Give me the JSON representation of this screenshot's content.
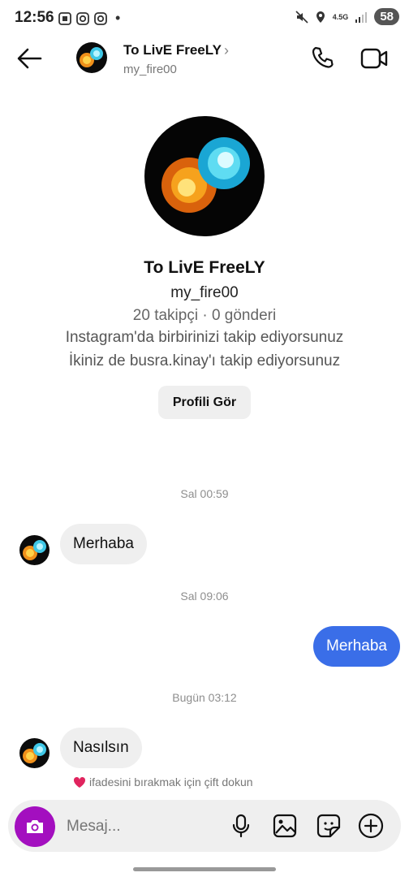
{
  "status_bar": {
    "time": "12:56",
    "network": "4.5G",
    "battery": "58"
  },
  "header": {
    "name": "To LivE FreeLY",
    "username": "my_fire00",
    "chevron": "›"
  },
  "profile": {
    "name": "To LivE FreeLY",
    "username": "my_fire00",
    "stats": "20 takipçi · 0 gönderi",
    "mutual_line": "Instagram'da birbirinizi takip ediyorsunuz",
    "common_line": "İkiniz de busra.kinay'ı takip ediyorsunuz",
    "view_profile_button": "Profili Gör"
  },
  "messages": [
    {
      "timestamp": "Sal 00:59",
      "direction": "in",
      "text": "Merhaba"
    },
    {
      "timestamp": "Sal 09:06",
      "direction": "out",
      "text": "Merhaba"
    },
    {
      "timestamp": "Bugün 03:12",
      "direction": "in",
      "text": "Nasılsın"
    }
  ],
  "hint": {
    "icon": "heart-icon",
    "text": "ifadesini bırakmak için çift dokun"
  },
  "composer": {
    "placeholder": "Mesaj..."
  },
  "colors": {
    "outgoing_bubble": "#3a6ee8",
    "camera_button": "#a30fbf"
  }
}
